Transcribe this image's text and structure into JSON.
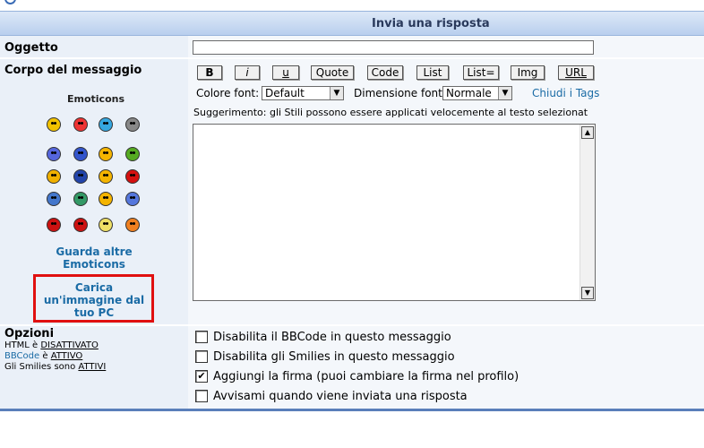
{
  "header": {
    "title": "Invia una risposta"
  },
  "subject": {
    "label": "Oggetto",
    "value": ""
  },
  "body": {
    "label": "Corpo del messaggio"
  },
  "toolbar": {
    "bold": "B",
    "italic": "i",
    "underline": "u",
    "quote": "Quote",
    "code": "Code",
    "list": "List",
    "list_eq": "List=",
    "img": "Img",
    "url": "URL",
    "font_color_label": "Colore font:",
    "font_color_value": "Default",
    "font_size_label": "Dimensione font:",
    "font_size_value": "Normale",
    "close_tags": "Chiudi i Tags",
    "hint": "Suggerimento: gli Stili possono essere applicati velocemente al testo selezionat"
  },
  "emoticons": {
    "title": "Emoticons",
    "more": "Guarda altre Emoticons",
    "upload": "Carica un'immagine dal tuo PC",
    "colors": [
      "#f2c200",
      "#e33",
      "#35a7e0",
      "#888",
      "#5566dd",
      "#3355cc",
      "#f4b400",
      "#55aa22",
      "#f0b000",
      "#2244aa",
      "#f4b400",
      "#d41010",
      "#4477cc",
      "#339966",
      "#f4b400",
      "#5577dd",
      "#cc1111",
      "#cc1111",
      "#eee066",
      "#f08020"
    ]
  },
  "options": {
    "title": "Opzioni",
    "html": "HTML è",
    "html_state": "DISATTIVATO",
    "bbcode": "BBCode",
    "bbcode_is": "è",
    "bbcode_state": "ATTIVO",
    "smilies": "Gli Smilies sono",
    "smilies_state": "ATTIVI",
    "items": [
      {
        "label": "Disabilita il BBCode in questo messaggio",
        "checked": false
      },
      {
        "label": "Disabilita gli Smilies in questo messaggio",
        "checked": false
      },
      {
        "label": "Aggiungi la firma (puoi cambiare la firma nel profilo)",
        "checked": true
      },
      {
        "label": "Avvisami quando viene inviata una risposta",
        "checked": false
      }
    ]
  }
}
